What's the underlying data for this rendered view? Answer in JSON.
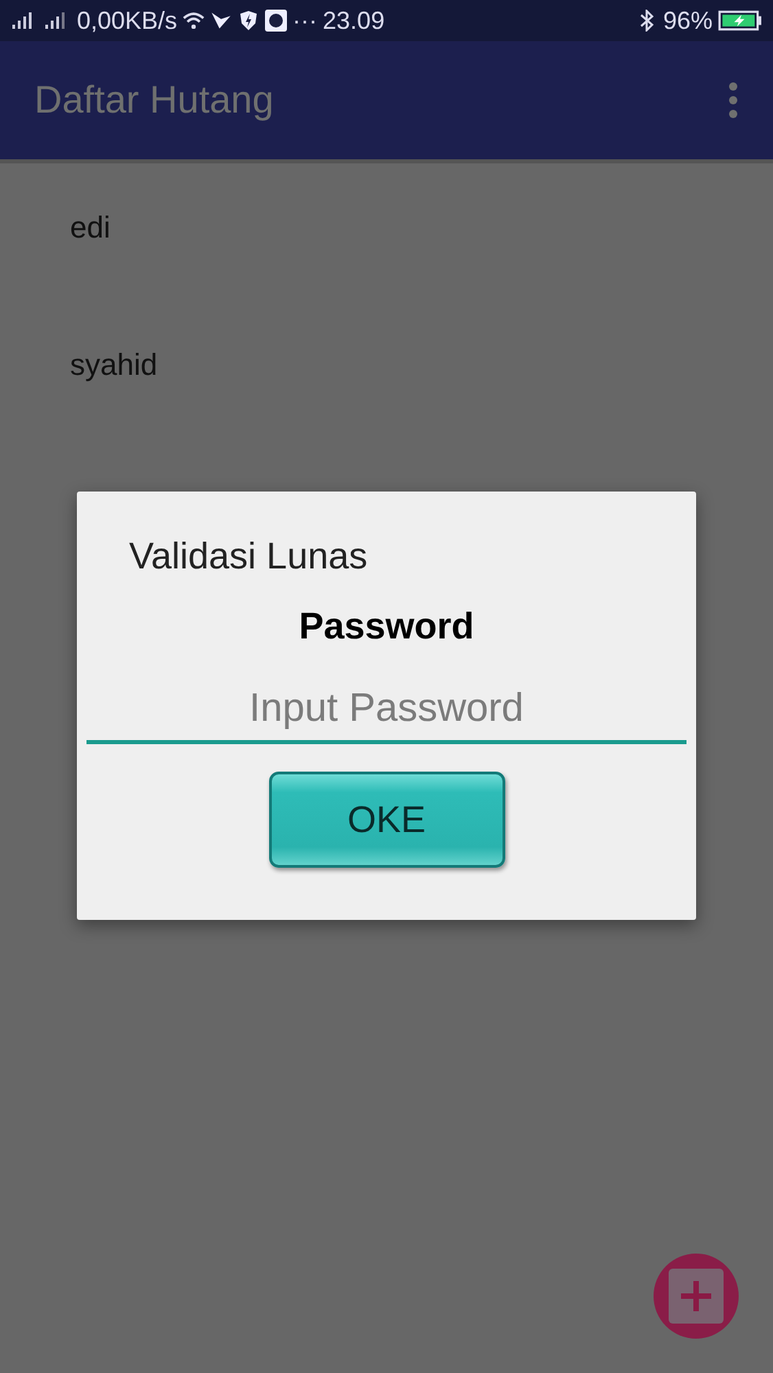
{
  "status_bar": {
    "speed": "0,00KB/s",
    "more": "···",
    "time": "23.09",
    "battery": "96%"
  },
  "app_bar": {
    "title": "Daftar Hutang"
  },
  "list": [
    {
      "name": "edi"
    },
    {
      "name": "syahid"
    }
  ],
  "dialog": {
    "title": "Validasi Lunas",
    "label": "Password",
    "field": {
      "placeholder": "Input Password"
    },
    "button": "OKE"
  }
}
